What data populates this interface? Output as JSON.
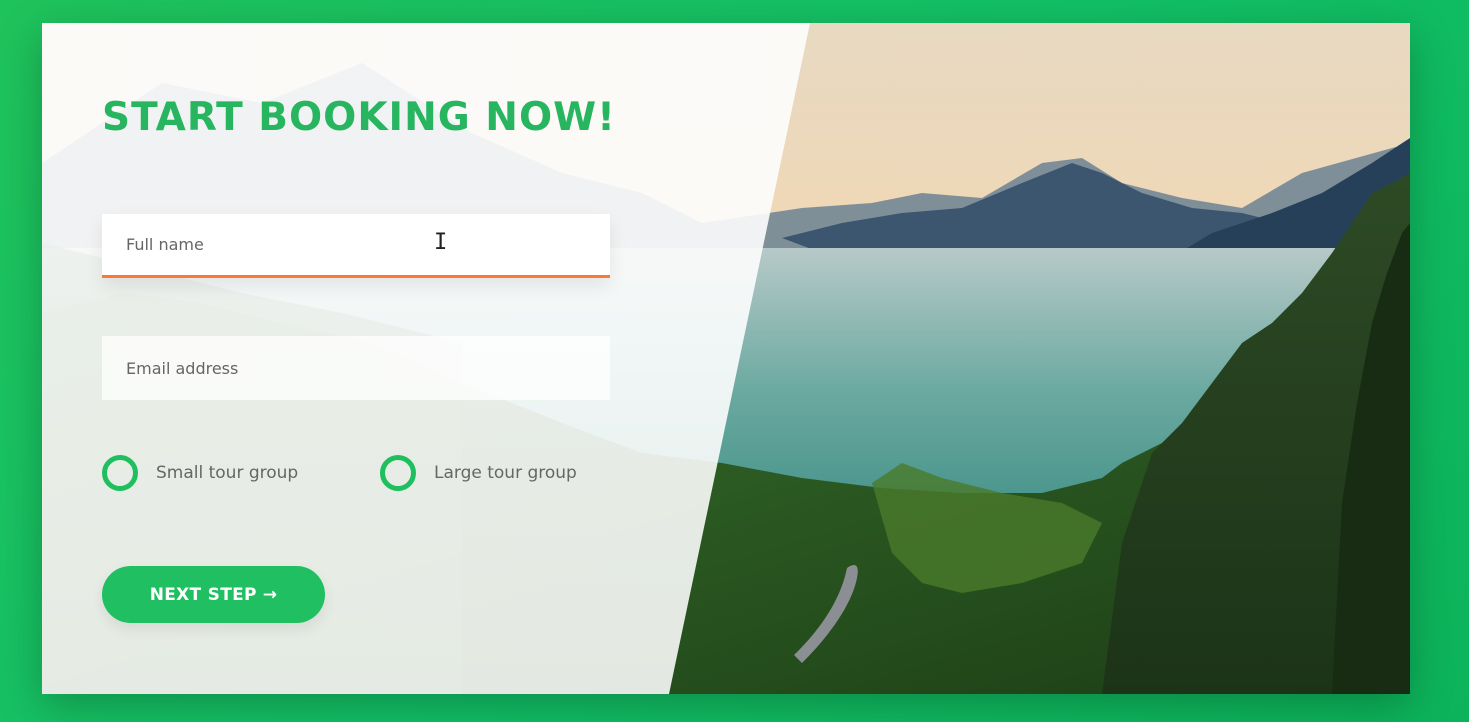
{
  "form": {
    "title": "START BOOKING NOW!",
    "full_name_placeholder": "Full name",
    "email_placeholder": "Email address",
    "radio_small_label": "Small tour group",
    "radio_large_label": "Large tour group",
    "next_button_label": "NEXT STEP",
    "next_button_arrow": "→",
    "cursor_glyph": "I"
  },
  "colors": {
    "accent_green": "#28b560",
    "button_green": "#1fbf62",
    "focus_underline": "#ff7730"
  }
}
